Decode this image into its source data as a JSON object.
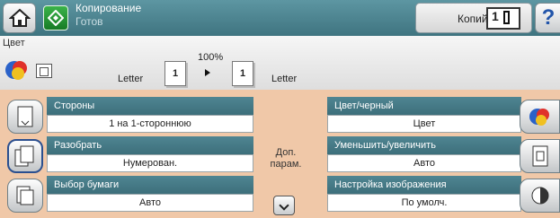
{
  "header": {
    "title": "Копирование",
    "status": "Готов",
    "copies_label": "Копий:",
    "copies_value": "1"
  },
  "preview": {
    "color_label": "Цвет",
    "zoom": "100%",
    "original_count": "1",
    "copy_count": "1",
    "original_size": "Letter",
    "copy_size": "Letter"
  },
  "options": {
    "sides": {
      "label": "Стороны",
      "value": "1 на 1-стороннюю"
    },
    "collate": {
      "label": "Разобрать",
      "value": "Нумерован."
    },
    "paper": {
      "label": "Выбор бумаги",
      "value": "Авто"
    },
    "color_mode": {
      "label": "Цвет/черный",
      "value": "Цвет"
    },
    "resize": {
      "label": "Уменьшить/увеличить",
      "value": "Авто"
    },
    "image_adjust": {
      "label": "Настройка изображения",
      "value": "По умолч."
    }
  },
  "more": {
    "label": "Доп. парам."
  },
  "colors": {
    "header": "#4a8490",
    "options_bg": "#f0c8a8",
    "tab": "#46808c"
  }
}
